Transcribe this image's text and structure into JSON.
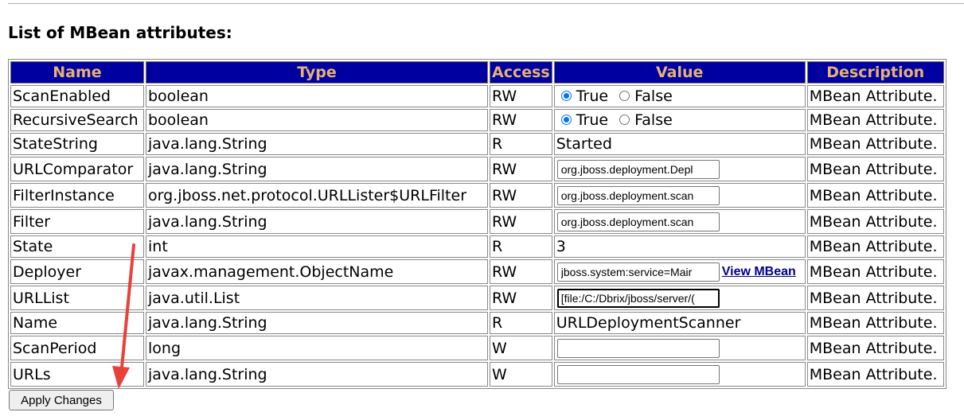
{
  "heading": "List of MBean attributes:",
  "columns": [
    "Name",
    "Type",
    "Access",
    "Value",
    "Description"
  ],
  "rows": [
    {
      "name": "ScanEnabled",
      "type": "boolean",
      "access": "RW",
      "true_label": "True",
      "false_label": "False",
      "selected": "True",
      "description": "MBean Attribute."
    },
    {
      "name": "RecursiveSearch",
      "type": "boolean",
      "access": "RW",
      "true_label": "True",
      "false_label": "False",
      "selected": "True",
      "description": "MBean Attribute."
    },
    {
      "name": "StateString",
      "type": "java.lang.String",
      "access": "R",
      "value": "Started",
      "description": "MBean Attribute."
    },
    {
      "name": "URLComparator",
      "type": "java.lang.String",
      "access": "RW",
      "value": "org.jboss.deployment.Depl",
      "description": "MBean Attribute."
    },
    {
      "name": "FilterInstance",
      "type": "org.jboss.net.protocol.URLLister$URLFilter",
      "access": "RW",
      "value": "org.jboss.deployment.scan",
      "description": "MBean Attribute."
    },
    {
      "name": "Filter",
      "type": "java.lang.String",
      "access": "RW",
      "value": "org.jboss.deployment.scan",
      "description": "MBean Attribute."
    },
    {
      "name": "State",
      "type": "int",
      "access": "R",
      "value": "3",
      "description": "MBean Attribute."
    },
    {
      "name": "Deployer",
      "type": "javax.management.ObjectName",
      "access": "RW",
      "value": "jboss.system:service=Mair",
      "link": "View MBean",
      "description": "MBean Attribute."
    },
    {
      "name": "URLList",
      "type": "java.util.List",
      "access": "RW",
      "value": "[file:/C:/Dbrix/jboss/server/(",
      "description": "MBean Attribute."
    },
    {
      "name": "Name",
      "type": "java.lang.String",
      "access": "R",
      "value": "URLDeploymentScanner",
      "description": "MBean Attribute."
    },
    {
      "name": "ScanPeriod",
      "type": "long",
      "access": "W",
      "value": "",
      "description": "MBean Attribute."
    },
    {
      "name": "URLs",
      "type": "java.lang.String",
      "access": "W",
      "value": "",
      "description": "MBean Attribute."
    }
  ],
  "apply_button": "Apply Changes",
  "colors": {
    "header_bg": "#0000a0",
    "header_text": "#e6b273",
    "link": "#00008b",
    "annotation_arrow": "#e8413c"
  }
}
